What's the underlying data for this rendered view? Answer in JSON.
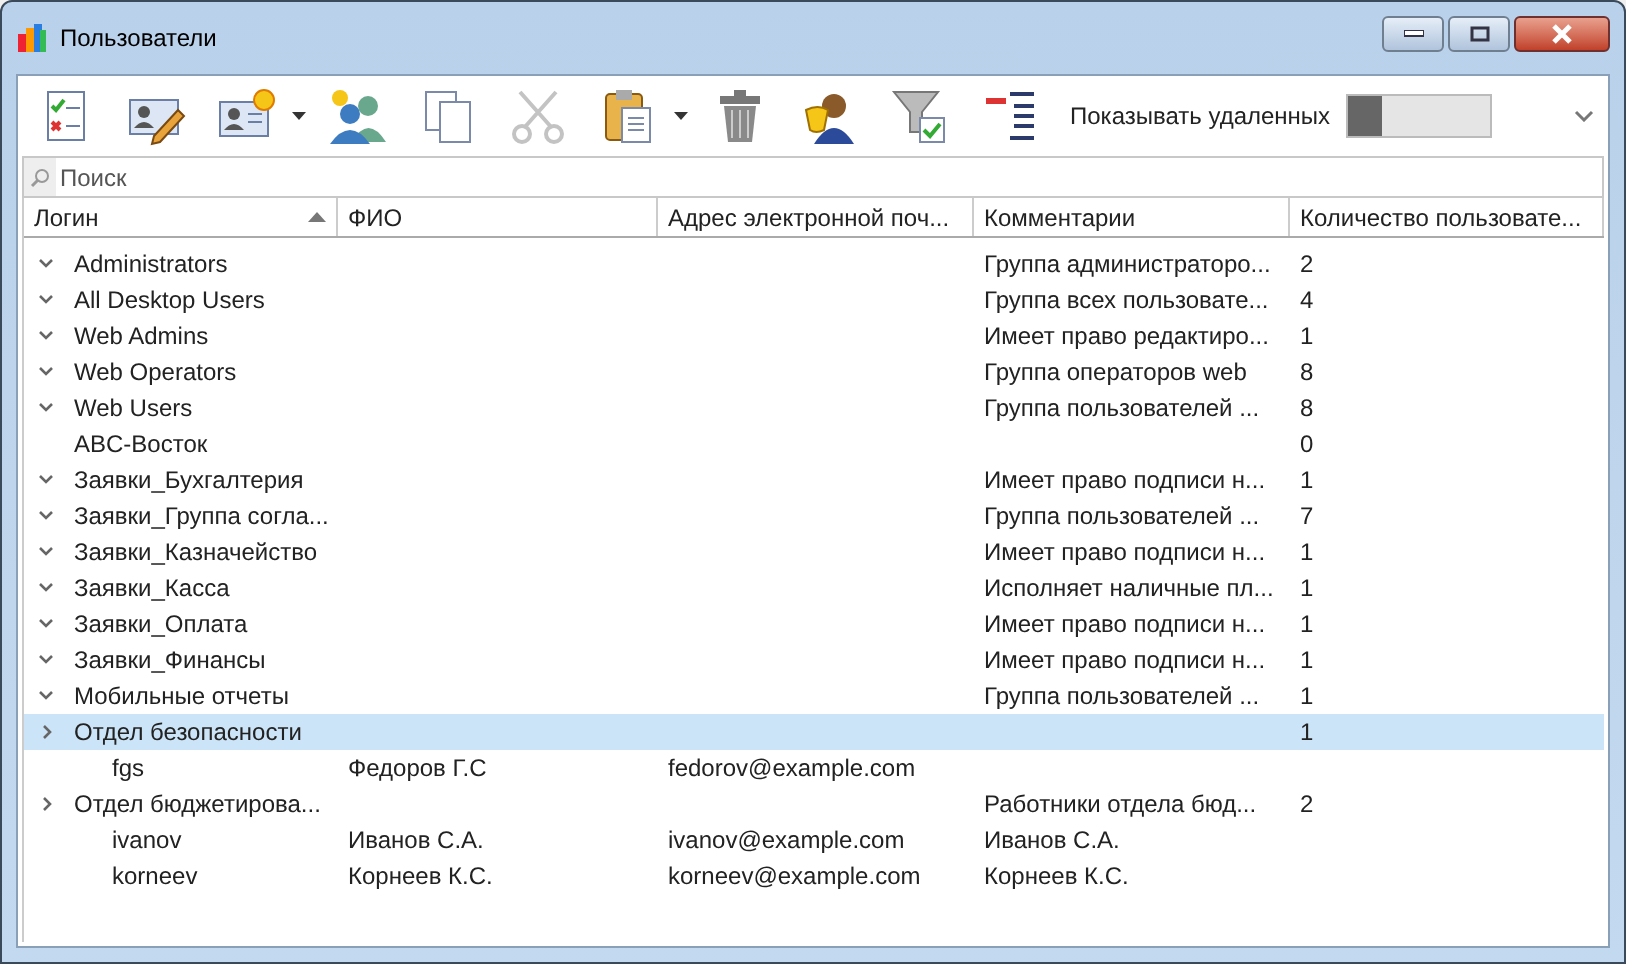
{
  "window": {
    "title": "Пользователи"
  },
  "toolbar": {
    "buttons": [
      {
        "kind": "checklist",
        "dropdown": false,
        "disabled": false
      },
      {
        "kind": "edit",
        "dropdown": false,
        "disabled": false
      },
      {
        "kind": "new",
        "dropdown": true,
        "disabled": false
      },
      {
        "kind": "group",
        "dropdown": false,
        "disabled": false
      },
      {
        "kind": "copy",
        "dropdown": false,
        "disabled": false
      },
      {
        "kind": "cut",
        "dropdown": false,
        "disabled": true
      },
      {
        "kind": "paste",
        "dropdown": true,
        "disabled": false
      },
      {
        "kind": "delete",
        "dropdown": false,
        "disabled": false
      },
      {
        "kind": "roles",
        "dropdown": false,
        "disabled": false
      },
      {
        "kind": "filter",
        "dropdown": false,
        "disabled": false
      },
      {
        "kind": "collapse",
        "dropdown": false,
        "disabled": false
      }
    ],
    "show_deleted": {
      "label": "Показывать удаленных",
      "on": false
    }
  },
  "search": {
    "placeholder": "Поиск"
  },
  "table": {
    "columns": [
      {
        "label": "Логин",
        "sorted": true
      },
      {
        "label": "ФИО",
        "sorted": false
      },
      {
        "label": "Адрес электронной поч...",
        "sorted": false
      },
      {
        "label": "Комментарии",
        "sorted": false
      },
      {
        "label": "Количество пользовате...",
        "sorted": false
      }
    ],
    "rows": [
      {
        "login": "Administrators",
        "comment": "Группа администраторо...",
        "count": "2",
        "expanded": true,
        "selected": false
      },
      {
        "login": "All Desktop Users",
        "comment": "Группа всех пользовате...",
        "count": "4",
        "expanded": true,
        "selected": false
      },
      {
        "login": "Web Admins",
        "comment": "Имеет право редактиро...",
        "count": "1",
        "expanded": true,
        "selected": false
      },
      {
        "login": "Web Operators",
        "comment": "Группа операторов web",
        "count": "8",
        "expanded": true,
        "selected": false
      },
      {
        "login": "Web Users",
        "comment": "Группа пользователей ...",
        "count": "8",
        "expanded": true,
        "selected": false
      },
      {
        "login": "ABC-Восток",
        "count": "0",
        "selected": false
      },
      {
        "login": "Заявки_Бухгалтерия",
        "comment": "Имеет право подписи н...",
        "count": "1",
        "expanded": true,
        "selected": false
      },
      {
        "login": "Заявки_Группа согла...",
        "comment": "Группа пользователей ...",
        "count": "7",
        "expanded": true,
        "selected": false
      },
      {
        "login": "Заявки_Казначейство",
        "comment": "Имеет право подписи н...",
        "count": "1",
        "expanded": true,
        "selected": false
      },
      {
        "login": "Заявки_Касса",
        "comment": "Исполняет наличные пл...",
        "count": "1",
        "expanded": true,
        "selected": false
      },
      {
        "login": "Заявки_Оплата",
        "comment": "Имеет право подписи н...",
        "count": "1",
        "expanded": true,
        "selected": false
      },
      {
        "login": "Заявки_Финансы",
        "comment": "Имеет право подписи н...",
        "count": "1",
        "expanded": true,
        "selected": false
      },
      {
        "login": "Мобильные отчеты",
        "comment": "Группа пользователей ...",
        "count": "1",
        "expanded": true,
        "selected": false
      },
      {
        "login": "Отдел безопасности",
        "count": "1",
        "expanded": false,
        "selected": true,
        "children": [
          {
            "login": "fgs",
            "name": "Федоров Г.С",
            "email": "fedorov@example.com",
            "selected": false
          }
        ]
      },
      {
        "login": "Отдел бюджетирова...",
        "comment": "Работники отдела бюд...",
        "count": "2",
        "expanded": false,
        "selected": false,
        "children": [
          {
            "login": "ivanov",
            "name": "Иванов С.А.",
            "email": "ivanov@example.com",
            "comment": "Иванов С.А.",
            "selected": false
          },
          {
            "login": "korneev",
            "name": "Корнеев К.С.",
            "email": "korneev@example.com",
            "comment": "Корнеев К.С.",
            "selected": false
          }
        ]
      }
    ]
  }
}
